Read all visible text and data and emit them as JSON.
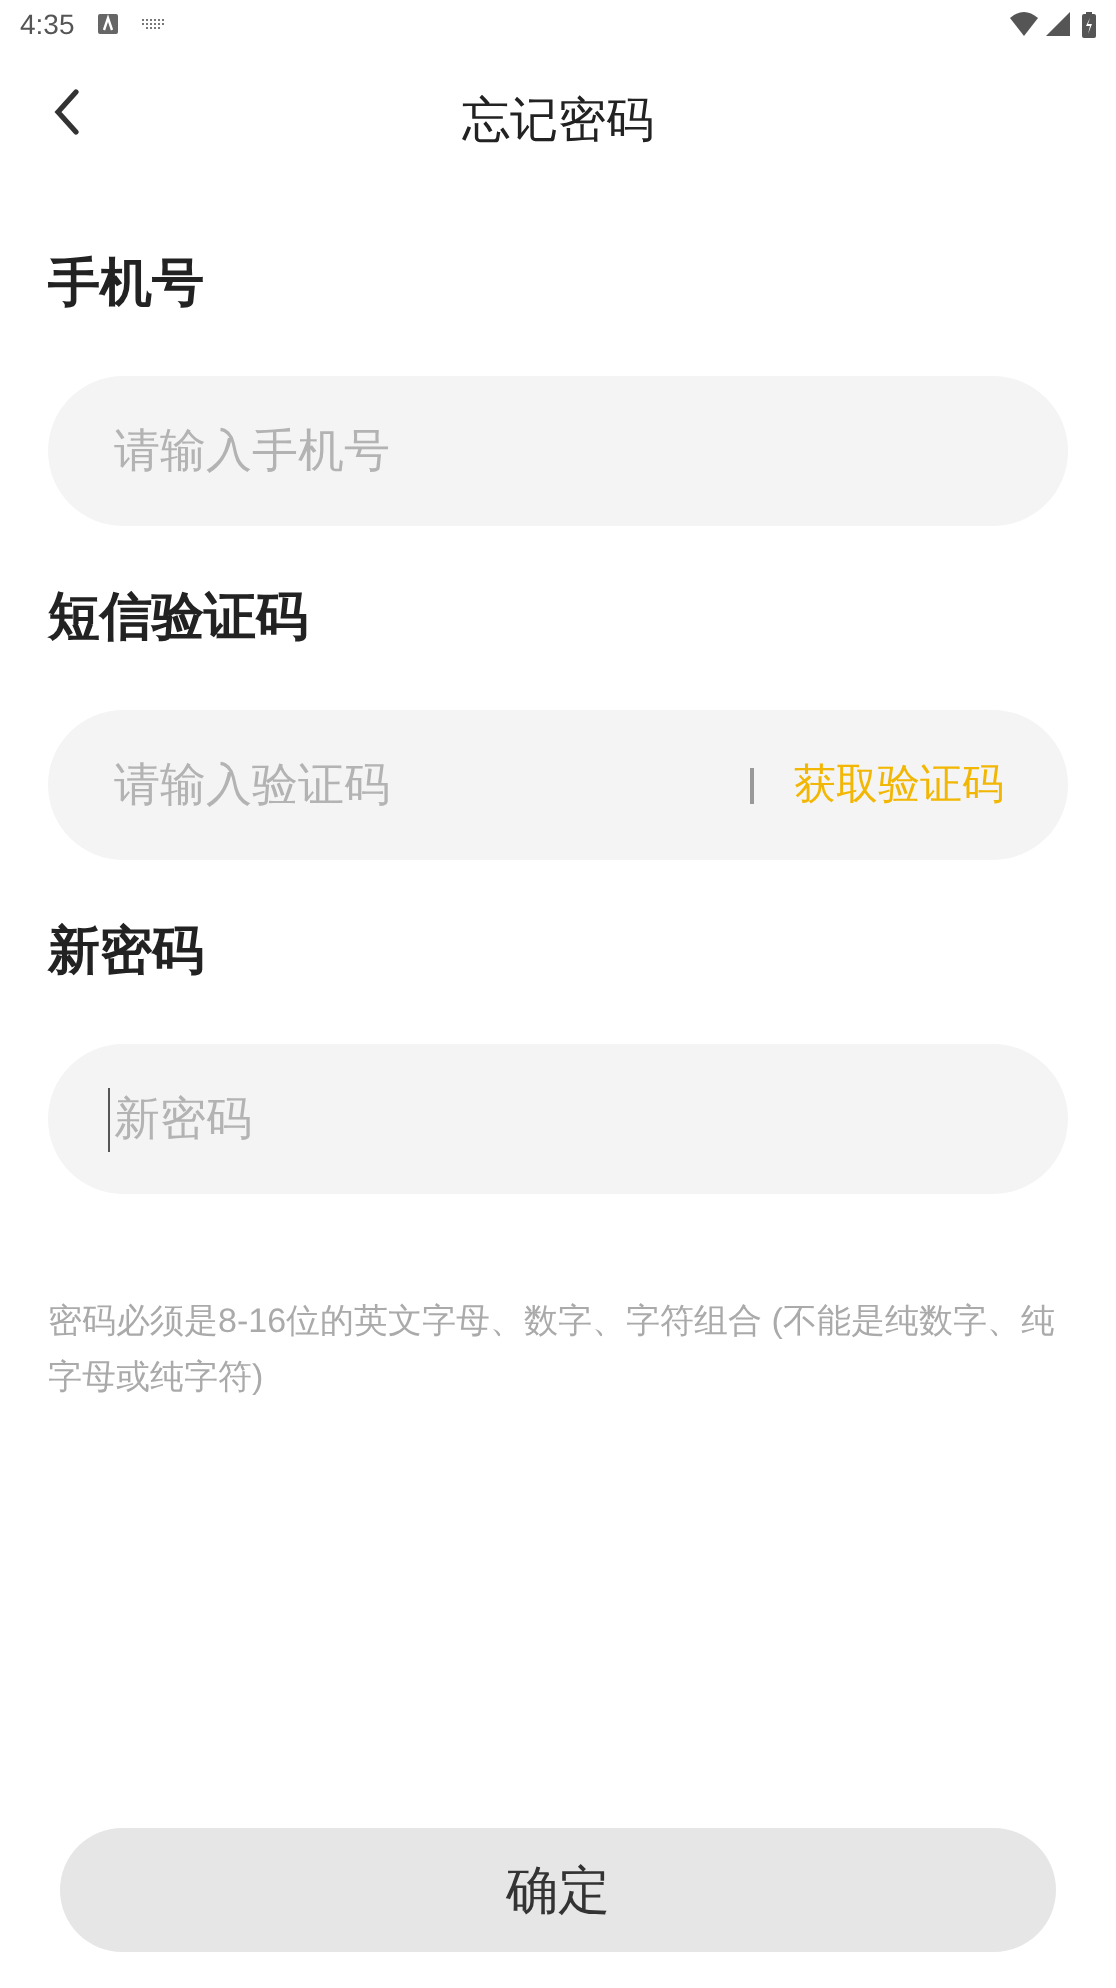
{
  "status_bar": {
    "time": "4:35"
  },
  "header": {
    "title": "忘记密码"
  },
  "fields": [
    {
      "label": "手机号",
      "placeholder": "请输入手机号",
      "focused": false
    },
    {
      "label": "短信验证码",
      "placeholder": "请输入验证码",
      "focused": false,
      "action": "获取验证码"
    },
    {
      "label": "新密码",
      "placeholder": "新密码",
      "focused": true
    }
  ],
  "hint": "密码必须是8-16位的英文字母、数字、字符组合 (不能是纯数字、纯字母或纯字符)",
  "submit": "确定"
}
